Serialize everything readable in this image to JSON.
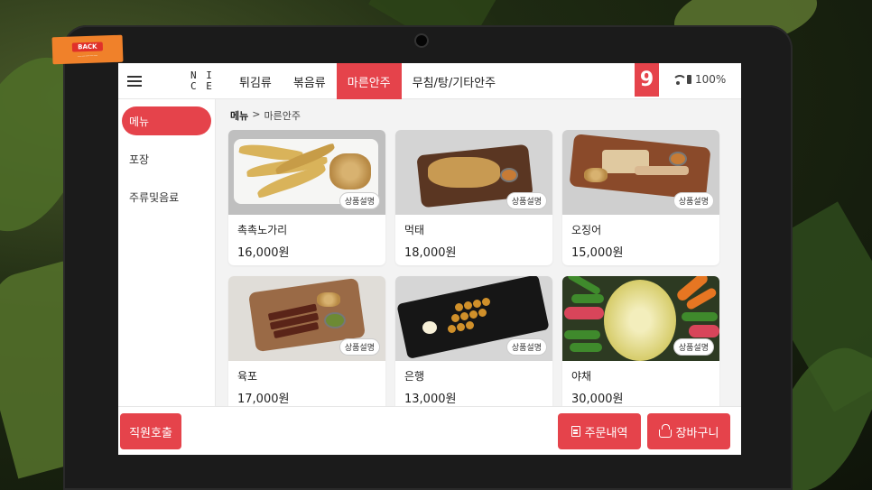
{
  "sticker": {
    "label": "BACK"
  },
  "header": {
    "logo_text": "NICE",
    "tabs": [
      {
        "label": "튀김류",
        "active": false
      },
      {
        "label": "볶음류",
        "active": false
      },
      {
        "label": "마른안주",
        "active": true
      },
      {
        "label": "무침/탕/기타안주",
        "active": false
      }
    ],
    "table_number": "9",
    "battery": "100%"
  },
  "sidebar": {
    "items": [
      {
        "label": "메뉴",
        "active": true
      },
      {
        "label": "포장",
        "active": false
      },
      {
        "label": "주류및음료",
        "active": false
      }
    ]
  },
  "breadcrumb": {
    "root": "메뉴",
    "separator": ">",
    "current": "마른안주"
  },
  "menu": {
    "desc_label": "상품설명",
    "items": [
      {
        "name": "촉촉노가리",
        "price": "16,000원",
        "image": "dried-pollack"
      },
      {
        "name": "먹태",
        "price": "18,000원",
        "image": "dried-pollack-strips"
      },
      {
        "name": "오징어",
        "price": "15,000원",
        "image": "dried-squid"
      },
      {
        "name": "육포",
        "price": "17,000원",
        "image": "beef-jerky"
      },
      {
        "name": "은행",
        "price": "13,000원",
        "image": "ginkgo-skewers"
      },
      {
        "name": "야채",
        "price": "30,000원",
        "image": "vegetable-sticks"
      }
    ]
  },
  "footer": {
    "call_staff": "직원호출",
    "order_history": "주문내역",
    "cart": "장바구니"
  },
  "colors": {
    "accent": "#e5434b"
  }
}
